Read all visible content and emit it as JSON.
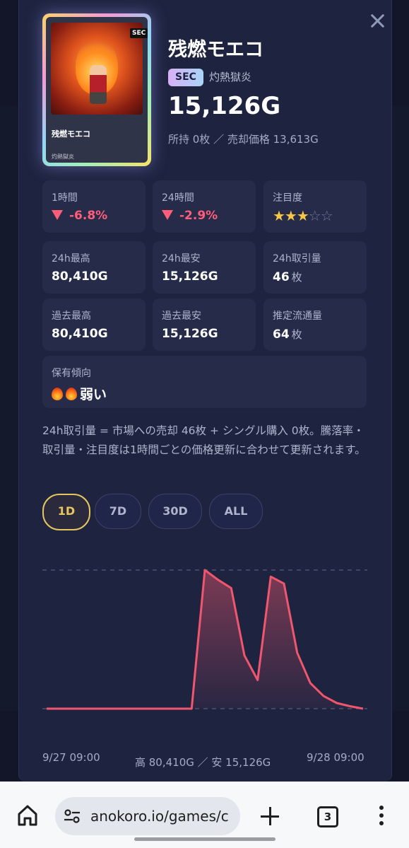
{
  "card": {
    "name": "残燃モエコ",
    "rarity": "SEC",
    "attribute": "灼熱獄炎",
    "price": "15,126G",
    "holdings": "所持 0枚 ／ 売却価格 13,613G",
    "image": {
      "rarity": "SEC",
      "name": "残燃モエコ",
      "attribute": "灼熱獄炎"
    }
  },
  "stats": {
    "change_1h": {
      "label": "1時間",
      "value": "-6.8%"
    },
    "change_24h": {
      "label": "24時間",
      "value": "-2.9%"
    },
    "attention": {
      "label": "注目度",
      "stars_on": "★★★",
      "stars_off": "☆☆",
      "rating": 3,
      "max": 5
    },
    "high_24h": {
      "label": "24h最高",
      "value": "80,410G"
    },
    "low_24h": {
      "label": "24h最安",
      "value": "15,126G"
    },
    "volume_24h": {
      "label": "24h取引量",
      "value": "46",
      "unit": "枚"
    },
    "all_high": {
      "label": "過去最高",
      "value": "80,410G"
    },
    "all_low": {
      "label": "過去最安",
      "value": "15,126G"
    },
    "circulation": {
      "label": "推定流通量",
      "value": "64",
      "unit": "枚"
    }
  },
  "holding": {
    "label": "保有傾向",
    "icon": "fire-icon",
    "icon_count": 2,
    "value": "弱い"
  },
  "note": "24h取引量 = 市場への売却 46枚 + シングル購入 0枚。騰落率・取引量・注目度は1時間ごとの価格更新に合わせて更新されます。",
  "tabs": [
    {
      "label": "1D",
      "active": true
    },
    {
      "label": "7D",
      "active": false
    },
    {
      "label": "30D",
      "active": false
    },
    {
      "label": "ALL",
      "active": false
    }
  ],
  "chart_data": {
    "type": "area",
    "title": "",
    "xlabel": "",
    "ylabel": "",
    "x_start": "9/27 09:00",
    "x_end": "9/28 09:00",
    "range_label": "高 80,410G ／ 安 15,126G",
    "ylim": [
      15126,
      80410
    ],
    "grid": "dashed lines at high and low",
    "color": "#f0566e",
    "series": [
      {
        "values": [
          15126,
          15126,
          15126,
          15126,
          15126,
          15126,
          15126,
          15126,
          15126,
          15126,
          15126,
          15126,
          80410,
          75800,
          71900,
          40200,
          28600,
          77300,
          74000,
          41500,
          27200,
          21100,
          17800,
          16300,
          15126
        ]
      }
    ]
  },
  "colors": {
    "accent": "#e6c55e",
    "negative": "#ff5d79",
    "star": "#f6c744",
    "line": "#f0566e"
  },
  "browser": {
    "url": "anokoro.io/games/c",
    "tab_count": "3"
  }
}
